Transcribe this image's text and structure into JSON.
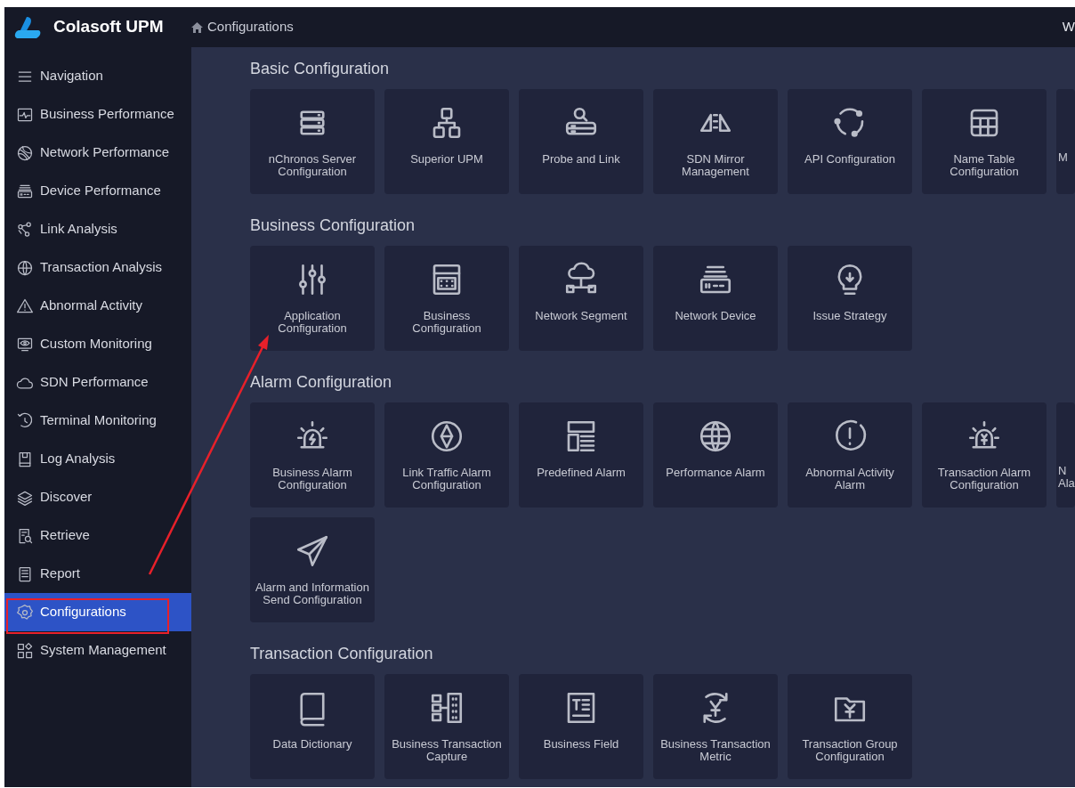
{
  "app": {
    "title": "Colasoft UPM",
    "breadcrumb": "Configurations",
    "user": "W"
  },
  "sidebar": {
    "items": [
      {
        "label": "Navigation",
        "selected": false
      },
      {
        "label": "Business Performance",
        "selected": false
      },
      {
        "label": "Network Performance",
        "selected": false
      },
      {
        "label": "Device Performance",
        "selected": false
      },
      {
        "label": "Link Analysis",
        "selected": false
      },
      {
        "label": "Transaction Analysis",
        "selected": false
      },
      {
        "label": "Abnormal Activity",
        "selected": false
      },
      {
        "label": "Custom Monitoring",
        "selected": false
      },
      {
        "label": "SDN Performance",
        "selected": false
      },
      {
        "label": "Terminal Monitoring",
        "selected": false
      },
      {
        "label": "Log Analysis",
        "selected": false
      },
      {
        "label": "Discover",
        "selected": false
      },
      {
        "label": "Retrieve",
        "selected": false
      },
      {
        "label": "Report",
        "selected": false
      },
      {
        "label": "Configurations",
        "selected": true
      },
      {
        "label": "System Management",
        "selected": false
      }
    ]
  },
  "sections": [
    {
      "title": "Basic Configuration",
      "tiles": [
        {
          "kind": "tile",
          "label": "nChronos Server Configuration"
        },
        {
          "kind": "tile",
          "label": "Superior UPM"
        },
        {
          "kind": "tile",
          "label": "Probe and Link"
        },
        {
          "kind": "tile",
          "label": "SDN Mirror Management"
        },
        {
          "kind": "tile",
          "label": "API Configuration"
        },
        {
          "kind": "tile",
          "label": "Name Table Configuration"
        },
        {
          "kind": "cut",
          "label": "M"
        }
      ]
    },
    {
      "title": "Business Configuration",
      "tiles": [
        {
          "kind": "tile",
          "label": "Application Configuration"
        },
        {
          "kind": "tile",
          "label": "Business Configuration"
        },
        {
          "kind": "tile",
          "label": "Network Segment"
        },
        {
          "kind": "tile",
          "label": "Network Device"
        },
        {
          "kind": "tile",
          "label": "Issue Strategy"
        }
      ]
    },
    {
      "title": "Alarm Configuration",
      "tiles": [
        {
          "kind": "tile",
          "label": "Business Alarm Configuration"
        },
        {
          "kind": "tile",
          "label": "Link Traffic Alarm Configuration"
        },
        {
          "kind": "tile",
          "label": "Predefined Alarm"
        },
        {
          "kind": "tile",
          "label": "Performance Alarm"
        },
        {
          "kind": "tile",
          "label": "Abnormal Activity Alarm"
        },
        {
          "kind": "tile",
          "label": "Transaction Alarm Configuration"
        },
        {
          "kind": "cut",
          "label": "N Ala"
        },
        {
          "kind": "tile",
          "label": "Alarm and Information Send Configuration"
        }
      ]
    },
    {
      "title": "Transaction Configuration",
      "tiles": [
        {
          "kind": "tile",
          "label": "Data Dictionary"
        },
        {
          "kind": "tile",
          "label": "Business Transaction Capture"
        },
        {
          "kind": "tile",
          "label": "Business Field"
        },
        {
          "kind": "tile",
          "label": "Business Transaction Metric"
        },
        {
          "kind": "tile",
          "label": "Transaction Group Configuration"
        }
      ]
    }
  ],
  "annotations": {
    "arrow": true,
    "frame": true
  }
}
